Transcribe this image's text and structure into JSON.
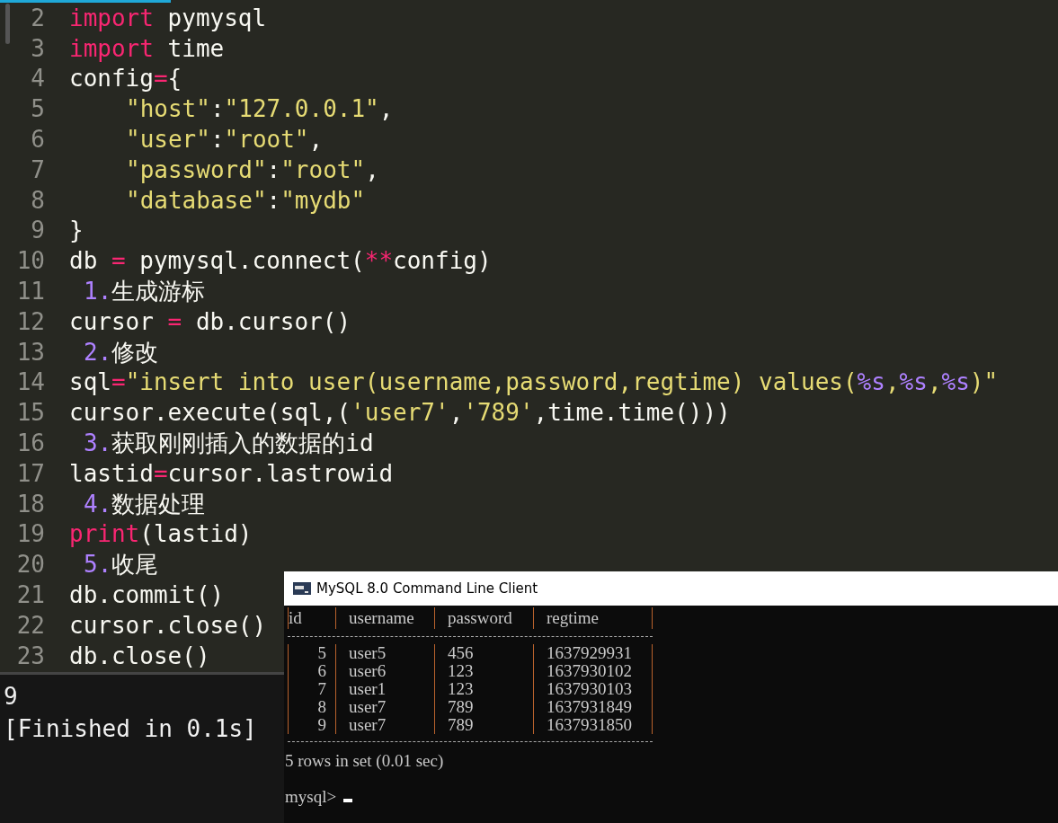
{
  "editor": {
    "lines": [
      {
        "number": "2",
        "tokens": [
          {
            "kind": "keyword",
            "text": "import"
          },
          {
            "kind": "plain",
            "text": " pymysql"
          }
        ]
      },
      {
        "number": "3",
        "tokens": [
          {
            "kind": "keyword",
            "text": "import"
          },
          {
            "kind": "plain",
            "text": " time"
          }
        ]
      },
      {
        "number": "4",
        "tokens": [
          {
            "kind": "plain",
            "text": "config"
          },
          {
            "kind": "operator",
            "text": "="
          },
          {
            "kind": "plain",
            "text": "{"
          }
        ]
      },
      {
        "number": "5",
        "kind": "block",
        "tokens": [
          {
            "kind": "string",
            "text": "\"host\""
          },
          {
            "kind": "plain",
            "text": ":"
          },
          {
            "kind": "string",
            "text": "\"127.0.0.1\""
          },
          {
            "kind": "plain",
            "text": ","
          }
        ]
      },
      {
        "number": "6",
        "kind": "block",
        "tokens": [
          {
            "kind": "string",
            "text": "\"user\""
          },
          {
            "kind": "plain",
            "text": ":"
          },
          {
            "kind": "string",
            "text": "\"root\""
          },
          {
            "kind": "plain",
            "text": ","
          }
        ]
      },
      {
        "number": "7",
        "kind": "block",
        "tokens": [
          {
            "kind": "string",
            "text": "\"password\""
          },
          {
            "kind": "plain",
            "text": ":"
          },
          {
            "kind": "string",
            "text": "\"root\""
          },
          {
            "kind": "plain",
            "text": ","
          }
        ]
      },
      {
        "number": "8",
        "kind": "block",
        "tokens": [
          {
            "kind": "string",
            "text": "\"database\""
          },
          {
            "kind": "plain",
            "text": ":"
          },
          {
            "kind": "string",
            "text": "\"mydb\""
          }
        ]
      },
      {
        "number": "9",
        "tokens": [
          {
            "kind": "plain",
            "text": "}"
          }
        ]
      },
      {
        "number": "10",
        "tokens": [
          {
            "kind": "plain",
            "text": "db "
          },
          {
            "kind": "operator",
            "text": "="
          },
          {
            "kind": "plain",
            "text": " pymysql.connect("
          },
          {
            "kind": "operator",
            "text": "**"
          },
          {
            "kind": "plain",
            "text": "config)"
          }
        ]
      },
      {
        "number": "11",
        "kind": "note",
        "tokens": [
          {
            "kind": "number",
            "text": "1."
          },
          {
            "kind": "plain",
            "text": "生成游标"
          }
        ]
      },
      {
        "number": "12",
        "tokens": [
          {
            "kind": "plain",
            "text": "cursor "
          },
          {
            "kind": "operator",
            "text": "="
          },
          {
            "kind": "plain",
            "text": " db.cursor()"
          }
        ]
      },
      {
        "number": "13",
        "kind": "note",
        "tokens": [
          {
            "kind": "number",
            "text": "2."
          },
          {
            "kind": "plain",
            "text": "修改"
          }
        ]
      },
      {
        "number": "14",
        "tokens": [
          {
            "kind": "plain",
            "text": "sql"
          },
          {
            "kind": "operator",
            "text": "="
          },
          {
            "kind": "string",
            "text": "\"insert into user(username,password,regtime) values("
          },
          {
            "kind": "number",
            "text": "%s"
          },
          {
            "kind": "string",
            "text": ","
          },
          {
            "kind": "number",
            "text": "%s"
          },
          {
            "kind": "string",
            "text": ","
          },
          {
            "kind": "number",
            "text": "%s"
          },
          {
            "kind": "string",
            "text": ")\""
          }
        ]
      },
      {
        "number": "15",
        "tokens": [
          {
            "kind": "plain",
            "text": "cursor.execute(sql,("
          },
          {
            "kind": "string",
            "text": "'user7'"
          },
          {
            "kind": "plain",
            "text": ","
          },
          {
            "kind": "string",
            "text": "'789'"
          },
          {
            "kind": "plain",
            "text": ",time.time()))"
          }
        ]
      },
      {
        "number": "16",
        "kind": "note",
        "tokens": [
          {
            "kind": "number",
            "text": "3."
          },
          {
            "kind": "plain",
            "text": "获取刚刚插入的数据的id"
          }
        ]
      },
      {
        "number": "17",
        "tokens": [
          {
            "kind": "plain",
            "text": "lastid"
          },
          {
            "kind": "operator",
            "text": "="
          },
          {
            "kind": "plain",
            "text": "cursor.lastrowid"
          }
        ]
      },
      {
        "number": "18",
        "kind": "note",
        "tokens": [
          {
            "kind": "number",
            "text": "4."
          },
          {
            "kind": "plain",
            "text": "数据处理"
          }
        ]
      },
      {
        "number": "19",
        "tokens": [
          {
            "kind": "keyword",
            "text": "print"
          },
          {
            "kind": "plain",
            "text": "(lastid)"
          }
        ]
      },
      {
        "number": "20",
        "kind": "note",
        "tokens": [
          {
            "kind": "number",
            "text": "5."
          },
          {
            "kind": "plain",
            "text": "收尾"
          }
        ]
      },
      {
        "number": "21",
        "tokens": [
          {
            "kind": "plain",
            "text": "db.commit()"
          }
        ]
      },
      {
        "number": "22",
        "tokens": [
          {
            "kind": "plain",
            "text": "cursor.close()"
          }
        ]
      },
      {
        "number": "23",
        "tokens": [
          {
            "kind": "plain",
            "text": "db.close()"
          }
        ]
      }
    ]
  },
  "output": {
    "lines": [
      "9",
      "[Finished in 0.1s]"
    ]
  },
  "mysql_window": {
    "title": "MySQL 8.0 Command Line Client",
    "table": {
      "columns": [
        "id",
        "username",
        "password",
        "regtime"
      ],
      "rows": [
        [
          "5",
          "user5",
          "456",
          "1637929931"
        ],
        [
          "6",
          "user6",
          "123",
          "1637930102"
        ],
        [
          "7",
          "user1",
          "123",
          "1637930103"
        ],
        [
          "8",
          "user7",
          "789",
          "1637931849"
        ],
        [
          "9",
          "user7",
          "789",
          "1637931850"
        ]
      ]
    },
    "result": "5 rows in set (0.01 sec)",
    "prompt": "mysql>"
  }
}
